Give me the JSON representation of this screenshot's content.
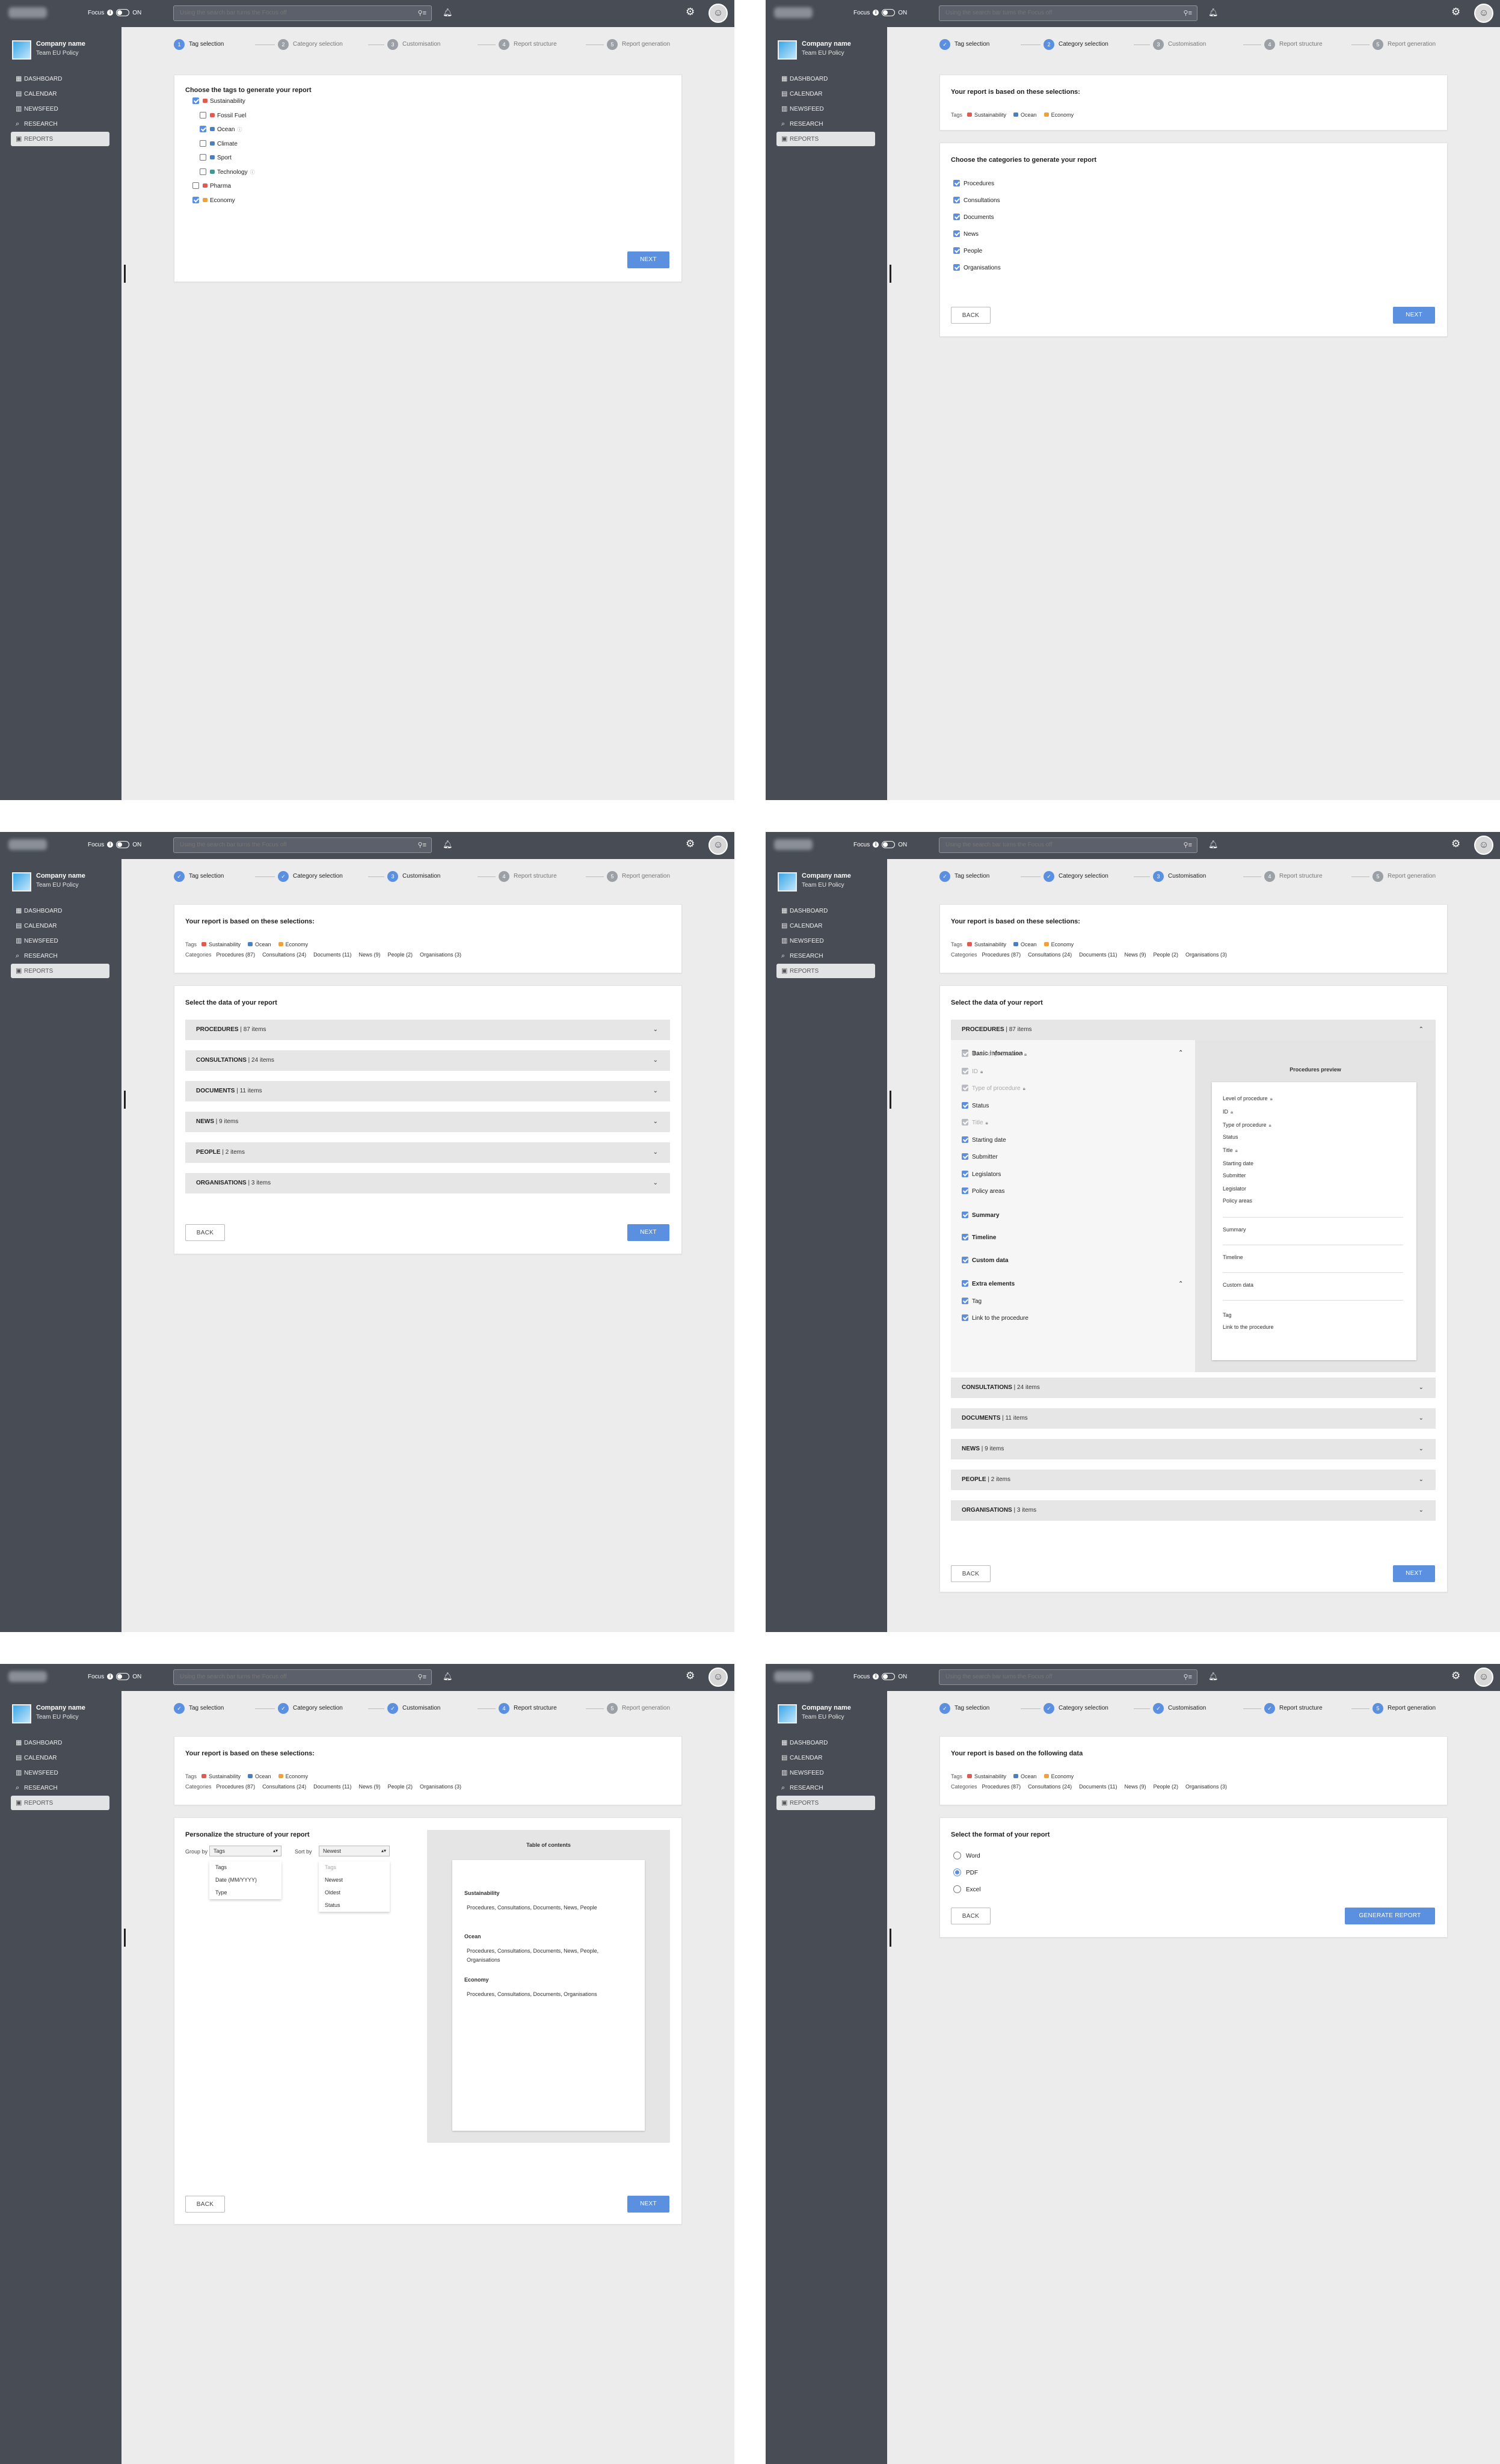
{
  "chrome": {
    "focus_label": "Focus",
    "focus_state": "ON",
    "search_placeholder": "Using the search bar turns the Focus off",
    "company_name": "Company name",
    "team_name": "Team EU Policy",
    "nav": [
      "DASHBOARD",
      "CALENDAR",
      "NEWSFEED",
      "RESEARCH",
      "REPORTS"
    ],
    "active_nav": "REPORTS"
  },
  "steps": [
    "Tag selection",
    "Category selection",
    "Customisation",
    "Report structure",
    "Report generation"
  ],
  "buttons": {
    "next": "NEXT",
    "back": "BACK",
    "generate": "GENERATE REPORT"
  },
  "colors": {
    "accent": "#5b8fe0",
    "sidebar": "#474c55",
    "tag_red": "#e05a4f",
    "tag_blue": "#4a7fc1",
    "tag_orange": "#f0a13a",
    "tag_green": "#3a9b8e"
  },
  "tag_step": {
    "title": "Choose the tags to generate your report",
    "tags": [
      {
        "label": "Sustainability",
        "checked": true,
        "color": "#e05a4f",
        "indent": 0
      },
      {
        "label": "Fossil Fuel",
        "checked": false,
        "color": "#e05a4f",
        "indent": 1
      },
      {
        "label": "Ocean",
        "checked": true,
        "color": "#4a7fc1",
        "indent": 1
      },
      {
        "label": "Climate",
        "checked": false,
        "color": "#4a7fc1",
        "indent": 1
      },
      {
        "label": "Sport",
        "checked": false,
        "color": "#4a7fc1",
        "indent": 1
      },
      {
        "label": "Technology",
        "checked": false,
        "color": "#3a9b8e",
        "indent": 1
      },
      {
        "label": "Pharma",
        "checked": false,
        "color": "#e05a4f",
        "indent": 0
      },
      {
        "label": "Economy",
        "checked": true,
        "color": "#f0a13a",
        "indent": 0
      }
    ]
  },
  "summary": {
    "title": "Your report is based on these selections:",
    "title_final": "Your report is based on the following data",
    "tags_label": "Tags",
    "tags": [
      "Sustainability",
      "Ocean",
      "Economy"
    ],
    "categories_label": "Categories",
    "categories": [
      "Procedures (87)",
      "Consultations (24)",
      "Documents (11)",
      "News (9)",
      "People (2)",
      "Organisations (3)"
    ]
  },
  "category_step": {
    "title": "Choose the categories to generate your report",
    "categories": [
      "Procedures",
      "Consultations",
      "Documents",
      "News",
      "People",
      "Organisations"
    ]
  },
  "data_step": {
    "title": "Select the data of your report",
    "sections": [
      {
        "name": "PROCEDURES",
        "count": "87 items"
      },
      {
        "name": "CONSULTATIONS",
        "count": "24 items"
      },
      {
        "name": "DOCUMENTS",
        "count": "11 items"
      },
      {
        "name": "NEWS",
        "count": "9 items"
      },
      {
        "name": "PEOPLE",
        "count": "2 items"
      },
      {
        "name": "ORGANISATIONS",
        "count": "3 items"
      }
    ],
    "basic_info": "Basic information",
    "fields": [
      {
        "label": "Level of procedure",
        "state": "disabled"
      },
      {
        "label": "ID",
        "state": "disabled"
      },
      {
        "label": "Type of procedure",
        "state": "disabled"
      },
      {
        "label": "Status",
        "state": "checked"
      },
      {
        "label": "Title",
        "state": "disabled"
      },
      {
        "label": "Starting date",
        "state": "checked"
      },
      {
        "label": "Submitter",
        "state": "checked"
      },
      {
        "label": "Legislators",
        "state": "checked"
      },
      {
        "label": "Policy areas",
        "state": "checked"
      }
    ],
    "groups": [
      "Summary",
      "Timeline",
      "Custom data",
      "Extra elements"
    ],
    "extra_fields": [
      "Tag",
      "Link to the procedure"
    ],
    "preview_title": "Procedures preview",
    "preview_fields": [
      "Level of procedure",
      "ID",
      "Type of procedure",
      "Status",
      "Title",
      "Starting date",
      "Submitter",
      "Legislator",
      "Policy areas"
    ],
    "preview_sections": [
      "Summary",
      "Timeline",
      "Custom data"
    ],
    "preview_extra": [
      "Tag",
      "Link to the procedure"
    ]
  },
  "structure_step": {
    "title": "Personalize the structure of your report",
    "group_by_label": "Group by",
    "group_by_value": "Tags",
    "group_options": [
      "Tags",
      "Date (MM/YYYY)",
      "Type"
    ],
    "sort_by_label": "Sort by",
    "sort_by_value": "Newest",
    "sort_options": [
      "Tags",
      "Newest",
      "Oldest",
      "Status"
    ],
    "toc_title": "Table of contents",
    "toc": [
      {
        "heading": "Sustainability",
        "body": "Procedures, Consultations, Documents, News, People"
      },
      {
        "heading": "Ocean",
        "body": "Procedures, Consultations, Documents, News, People, Organisations"
      },
      {
        "heading": "Economy",
        "body": "Procedures, Consultations, Documents, Organisations"
      }
    ]
  },
  "format_step": {
    "title": "Select the format of your report",
    "options": [
      "Word",
      "PDF",
      "Excel"
    ],
    "selected": "PDF"
  }
}
